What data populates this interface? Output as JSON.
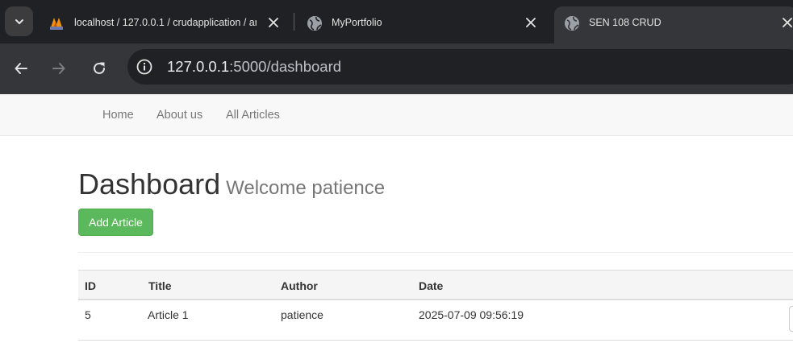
{
  "browser": {
    "tabs": [
      {
        "title": "localhost / 127.0.0.1 / crudapplication / ar",
        "favicon": "phpmyadmin-icon",
        "active": false
      },
      {
        "title": "MyPortfolio",
        "favicon": "globe-icon",
        "active": false
      },
      {
        "title": "SEN 108 CRUD",
        "favicon": "globe-icon",
        "active": true
      }
    ],
    "url_host": "127.0.0.1",
    "url_rest": ":5000/dashboard"
  },
  "navbar": {
    "links": [
      "Home",
      "About us",
      "All Articles"
    ]
  },
  "dashboard": {
    "title": "Dashboard",
    "welcome": "Welcome patience",
    "add_button": "Add Article"
  },
  "table": {
    "headers": [
      "ID",
      "Title",
      "Author",
      "Date"
    ],
    "rows": [
      {
        "id": "5",
        "title": "Article 1",
        "author": "patience",
        "date": "2025-07-09 09:56:19"
      }
    ]
  },
  "colors": {
    "tabstrip": "#202124",
    "toolbar": "#35363a",
    "success": "#5cb85c",
    "navbar": "#f8f8f8"
  }
}
